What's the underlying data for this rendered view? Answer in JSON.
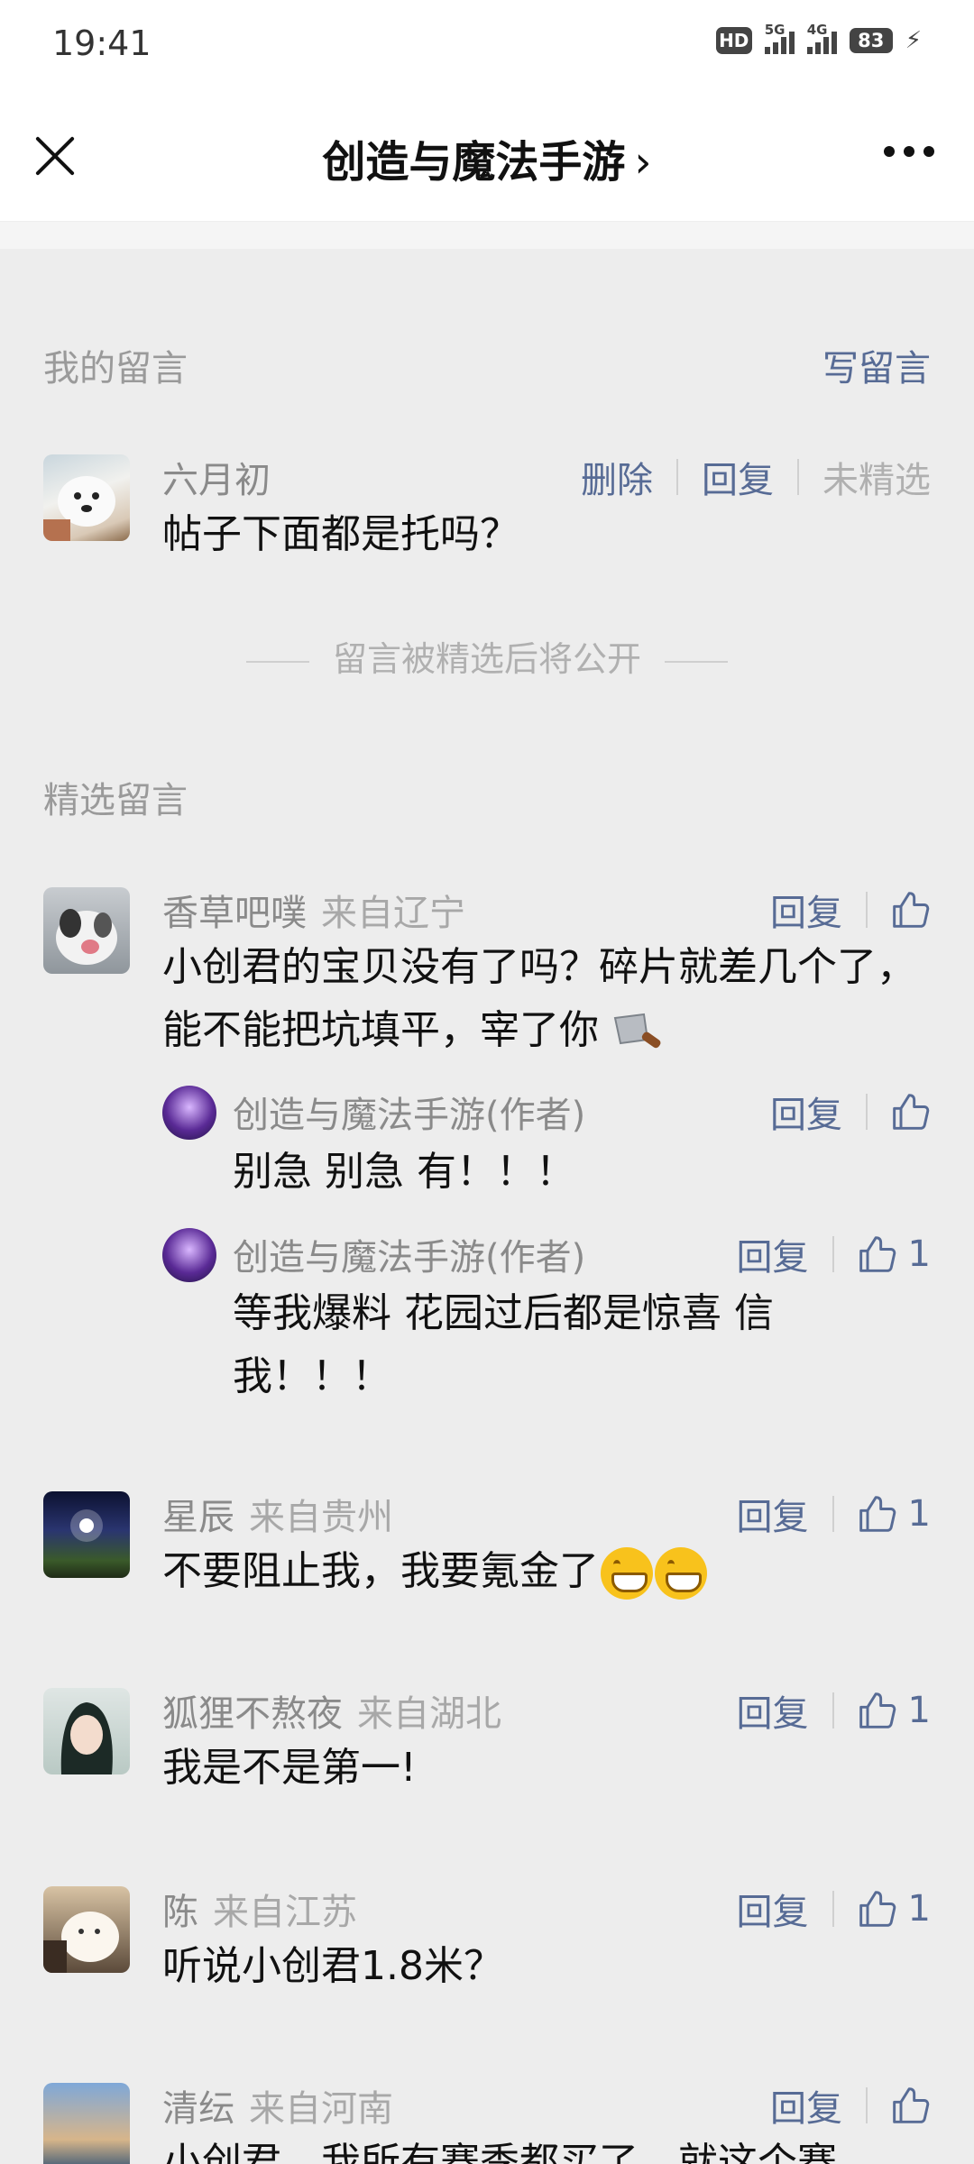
{
  "status_bar": {
    "time": "19:41",
    "hd": "HD",
    "sig5g": "5G",
    "sig4g": "4G",
    "battery": "83"
  },
  "nav": {
    "title": "创造与魔法手游",
    "chevron": "›"
  },
  "my_comment": {
    "section_label": "我的留言",
    "write_label": "写留言",
    "name": "六月初",
    "text": "帖子下面都是托吗？",
    "actions": [
      "删除",
      "回复",
      "未精选"
    ],
    "note": "留言被精选后将公开"
  },
  "featured": {
    "section_label": "精选留言",
    "comments": [
      {
        "name": "香草吧噗",
        "from": "来自辽宁",
        "text": "小创君的宝贝没有了吗？碎片就差几个了，能不能把坑填平，宰了你",
        "reply_label": "回复",
        "likes": "",
        "replies": [
          {
            "name": "创造与魔法手游(作者)",
            "text": "别急 别急 有！！！",
            "reply_label": "回复",
            "likes": ""
          },
          {
            "name": "创造与魔法手游(作者)",
            "text": "等我爆料 花园过后都是惊喜 信我！！！",
            "reply_label": "回复",
            "likes": "1"
          }
        ]
      },
      {
        "name": "星辰",
        "from": "来自贵州",
        "text": "不要阻止我，我要氪金了",
        "reply_label": "回复",
        "likes": "1"
      },
      {
        "name": "狐狸不熬夜",
        "from": "来自湖北",
        "text": "我是不是第一!",
        "reply_label": "回复",
        "likes": "1"
      },
      {
        "name": "陈",
        "from": "来自江苏",
        "text": "听说小创君1.8米？",
        "reply_label": "回复",
        "likes": "1"
      },
      {
        "name": "清纭",
        "from": "来自河南",
        "text": "小创君，我所有赛季都买了，就这个赛",
        "reply_label": "回复",
        "likes": ""
      }
    ]
  }
}
